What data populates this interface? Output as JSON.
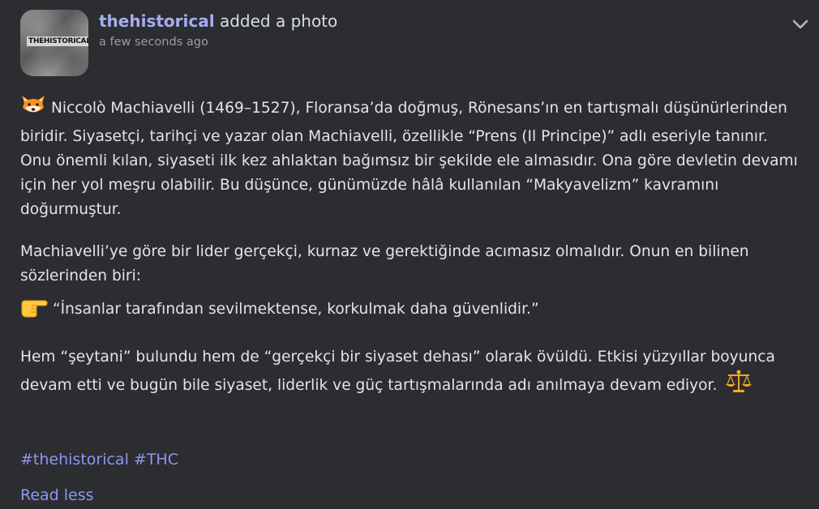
{
  "post": {
    "author": "thehistorical",
    "action": "added a photo",
    "timestamp": "a few seconds ago",
    "avatar_text": "THEHISTORICAL",
    "paragraph1": "Niccolò Machiavelli (1469–1527), Floransa’da doğmuş, Rönesans’ın en tartışmalı düşünürlerinden biridir. Siyasetçi, tarihçi ve yazar olan Machiavelli, özellikle “Prens (Il Principe)” adlı eseriyle tanınır. Onu önemli kılan, siyaseti ilk kez ahlaktan bağımsız bir şekilde ele almasıdır. Ona göre devletin devamı için her yol meşru olabilir. Bu düşünce, günümüzde hâlâ kullanılan “Makyavelizm” kavramını doğurmuştur.",
    "paragraph2": "Machiavelli’ye göre bir lider gerçekçi, kurnaz ve gerektiğinde acımasız olmalıdır. Onun en bilinen sözlerinden biri:",
    "quote": "“İnsanlar tarafından sevilmektense, korkulmak daha güvenlidir.”",
    "paragraph3": "Hem “şeytani” bulundu hem de “gerçekçi bir siyaset dehası” olarak övüldü. Etkisi yüzyıllar boyunca devam etti ve bugün bile siyaset, liderlik ve güç tartışmalarında adı anılmaya devam ediyor.",
    "hashtags": [
      "#thehistorical",
      "#THC"
    ],
    "read_less": "Read less"
  },
  "icons": {
    "fox": "fox-emoji-icon",
    "pointing": "backhand-index-pointing-right-icon",
    "scales": "balance-scale-icon",
    "chevron": "chevron-down-icon"
  },
  "colors": {
    "background": "#2b2d31",
    "author": "#a5acf0",
    "link": "#8e96f2",
    "text": "#e2e4e8",
    "muted": "#9a9ca3"
  }
}
